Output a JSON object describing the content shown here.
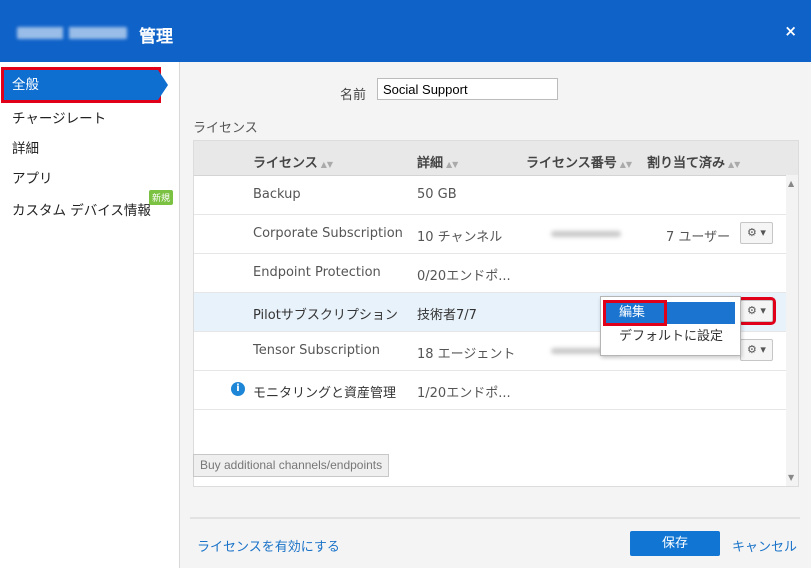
{
  "window": {
    "title": "管理",
    "close_label": "×"
  },
  "sidebar": {
    "items": [
      {
        "label": "全般"
      },
      {
        "label": "チャージレート"
      },
      {
        "label": "詳細"
      },
      {
        "label": "アプリ"
      },
      {
        "label": "カスタム デバイス情報"
      }
    ],
    "new_badge": "新規"
  },
  "form": {
    "name_label": "名前",
    "name_value": "Social Support"
  },
  "license": {
    "section_title": "ライセンス",
    "columns": [
      "ライセンス",
      "詳細",
      "ライセンス番号",
      "割り当て済み"
    ],
    "sort_glyph": "▲▼",
    "rows": [
      {
        "name": "Backup",
        "detail": "50 GB",
        "assigned": ""
      },
      {
        "name": "Corporate Subscription",
        "detail": "10 チャンネル",
        "assigned": "7 ユーザー"
      },
      {
        "name": "Endpoint Protection",
        "detail": "0/20エンドポ...",
        "assigned": ""
      },
      {
        "name": "Pilotサブスクリプション",
        "detail": "技術者7/7",
        "assigned": ""
      },
      {
        "name": "Tensor Subscription",
        "detail": "18 エージェント",
        "assigned": ""
      },
      {
        "name": "モニタリングと資産管理",
        "detail": "1/20エンドポ...",
        "assigned": ""
      }
    ],
    "gear_label": "⚙ ▾",
    "info_glyph": "i"
  },
  "context_menu": {
    "items": [
      "編集",
      "デフォルトに設定"
    ]
  },
  "buttons": {
    "buy": "Buy additional channels/endpoints",
    "activate": "ライセンスを有効にする",
    "save": "保存",
    "cancel": "キャンセル"
  }
}
